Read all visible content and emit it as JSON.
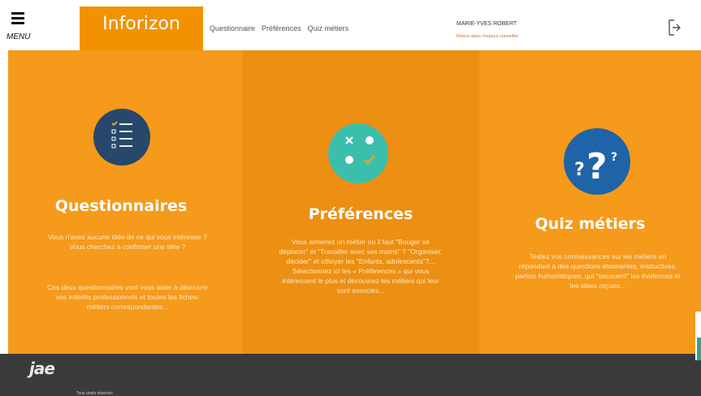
{
  "header": {
    "menu_label": "MENU",
    "logo": "Inforizon",
    "nav": [
      "Questionnaire",
      "Préférences",
      "Quiz métiers"
    ],
    "user_name": "MARIE-YVES ROBERT",
    "user_link": "Retour dans l'espace conseiller"
  },
  "panels": [
    {
      "title": "Questionnaires",
      "text1": "Vous n'avez aucune idée de ce qui vous intéresse ? Vous cherchez à confirmer une idée ?",
      "text2": "Ces deux questionnaires vont vous aider à découvrir vos intérêts professionnels et toutes les fiches-métiers correspondantes...",
      "icon": "checklist-icon"
    },
    {
      "title": "Préférences",
      "text1": "Vous aimeriez un métier où il faut \"Bouger se déplacer\" et \"Travailler avec ses mains\" ? \"Organiser, décider\" et côtoyer les \"Enfants, adolescents\"?... Sélectionnez ici les « Préférences » qui vous intéressent le plus et découvrez les métiers qui leur sont associés...",
      "icon": "preferences-icon"
    },
    {
      "title": "Quiz métiers",
      "text1": "Testez vos connaissances sur les métiers en répondant à des questions étonnantes, instructives, parfois humoristiques, qui \"secouent\" les évidences et les idées reçues...",
      "icon": "question-marks-icon"
    }
  ],
  "footer": {
    "logo": "jae",
    "copyright": "Tous droits réservés"
  },
  "colors": {
    "orange": "#f59a1b",
    "orange_dark": "#ec8f12",
    "navy": "#27476b",
    "teal": "#3bbfad",
    "blue": "#1f63a8",
    "footer": "#3b3b3b"
  }
}
